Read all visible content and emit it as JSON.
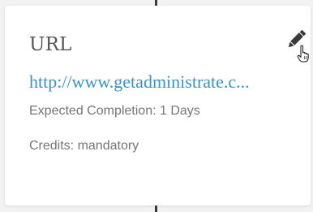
{
  "card": {
    "title": "URL",
    "link": "http://www.getadministrate.c...",
    "expected_completion": "Expected Completion: 1 Days",
    "credits": "Credits: mandatory"
  },
  "icons": {
    "edit": "pencil-icon",
    "cursor": "hand-pointer-icon"
  },
  "colors": {
    "link": "#3a93c7",
    "title": "#555555",
    "meta": "#757575",
    "icon": "#3a3a3a",
    "card_bg": "#ffffff",
    "page_bg": "#f2f2f2"
  }
}
